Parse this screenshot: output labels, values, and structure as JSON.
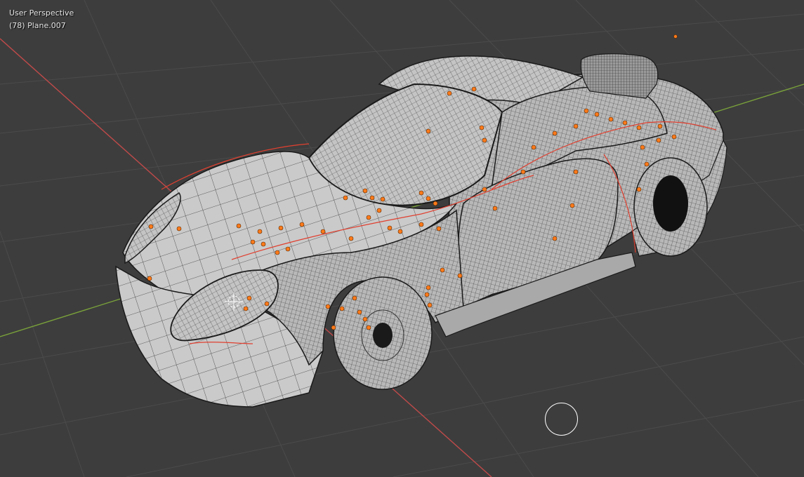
{
  "viewport": {
    "view_name": "User Perspective",
    "object_info": "(78) Plane.007"
  },
  "icons": {
    "brush_cursor": "brush-circle-cursor",
    "origin": "3d-cursor-icon"
  },
  "colors": {
    "background": "#3d3d3d",
    "grid": "#4a4a4a",
    "x_axis": "#c04a4a",
    "y_axis": "#7aa23a",
    "mesh_fill": "#bdbdbd",
    "wire": "#2a2a2a",
    "selected_vertex": "#ff7a1a",
    "seam": "#e04030"
  }
}
